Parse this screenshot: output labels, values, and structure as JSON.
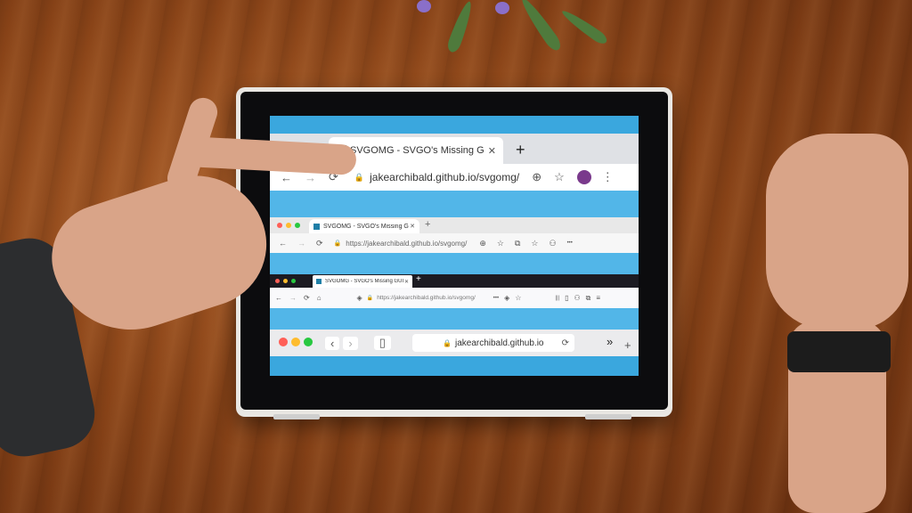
{
  "chrome": {
    "tab_title": "SVGOMG - SVGO's Missing GUI",
    "close": "✕",
    "new_tab": "+",
    "url": "jakearchibald.github.io/svgomg/"
  },
  "edge": {
    "tab_title": "SVGOMG - SVGO's Missing GUI",
    "close": "✕",
    "new_tab": "+",
    "url": "https://jakearchibald.github.io/svgomg/"
  },
  "firefox": {
    "tab_title": "SVGOMG - SVGO's Missing GUI",
    "close": "✕",
    "new_tab": "+",
    "url": "https://jakearchibald.github.io/svgomg/",
    "more": "•••"
  },
  "safari": {
    "url": "jakearchibald.github.io",
    "overflow": "»",
    "new_tab": "+"
  },
  "icons": {
    "back": "←",
    "forward": "→",
    "reload": "⟳",
    "home": "⌂",
    "lock": "🔒",
    "add": "⊕",
    "star": "☆",
    "menu": "⋮",
    "collections": "⧉",
    "profile": "⚇",
    "library": "|||",
    "sidebar": "▯",
    "shield": "◈",
    "hamburger": "≡",
    "safari_back": "‹",
    "safari_forward": "›"
  },
  "colors": {
    "screen": "#3aa7de",
    "mac_red": "#ff5f57",
    "mac_yellow": "#febc2e",
    "mac_green": "#28c840",
    "favicon": "#1f7fa7"
  }
}
